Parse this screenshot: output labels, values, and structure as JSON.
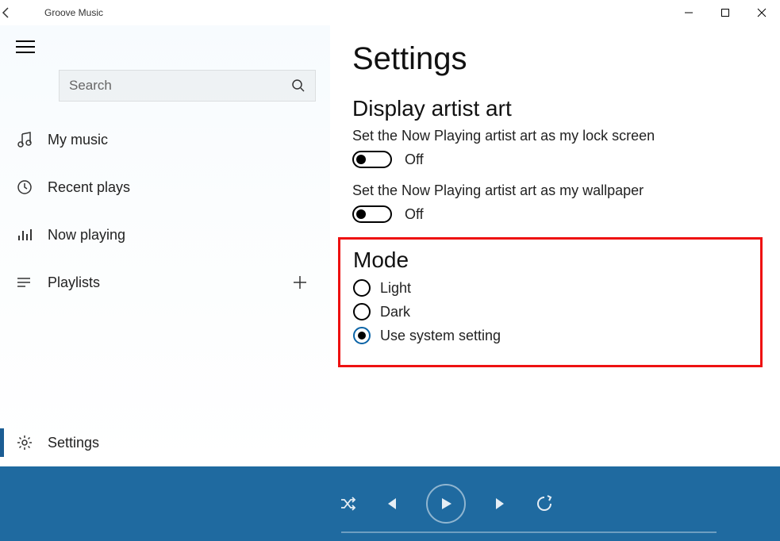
{
  "app": {
    "title": "Groove Music"
  },
  "sidebar": {
    "search_placeholder": "Search",
    "items": [
      {
        "label": "My music"
      },
      {
        "label": "Recent plays"
      },
      {
        "label": "Now playing"
      },
      {
        "label": "Playlists"
      }
    ],
    "settings_label": "Settings"
  },
  "settings": {
    "heading": "Settings",
    "artist_art": {
      "heading": "Display artist art",
      "lock_label": "Set the Now Playing artist art as my lock screen",
      "lock_state": "Off",
      "wall_label": "Set the Now Playing artist art as my wallpaper",
      "wall_state": "Off"
    },
    "mode": {
      "heading": "Mode",
      "options": [
        {
          "label": "Light",
          "selected": false
        },
        {
          "label": "Dark",
          "selected": false
        },
        {
          "label": "Use system setting",
          "selected": true
        }
      ]
    }
  }
}
